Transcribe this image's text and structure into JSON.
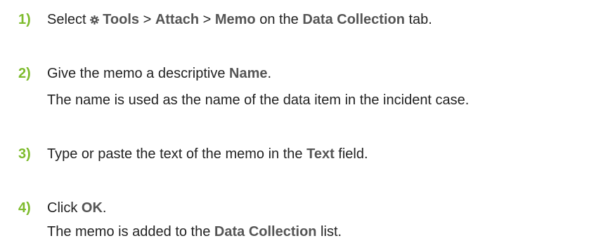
{
  "steps": [
    {
      "number": "1)",
      "line1": {
        "t1": "Select ",
        "tools": "Tools",
        "sep1": " > ",
        "attach": "Attach",
        "sep2": " > ",
        "memo": "Memo",
        "t2": " on the ",
        "tab": "Data Collection",
        "t3": " tab."
      }
    },
    {
      "number": "2)",
      "line1": {
        "t1": "Give the memo a descriptive ",
        "name": "Name",
        "t2": "."
      },
      "line2": "The name is used as the name of the data item in the incident case."
    },
    {
      "number": "3)",
      "line1": {
        "t1": "Type or paste the text of the memo in the ",
        "field": "Text",
        "t2": " field."
      }
    },
    {
      "number": "4)",
      "line1": {
        "t1": "Click ",
        "ok": "OK",
        "t2": "."
      },
      "line2": {
        "t1": "The memo is added to the ",
        "list": "Data Collection",
        "t2": " list."
      }
    }
  ],
  "icons": {
    "tools_icon": "gear-icon"
  },
  "colors": {
    "step_number": "#7dbb2c",
    "ui_term": "#555555",
    "body_text": "#222222"
  }
}
